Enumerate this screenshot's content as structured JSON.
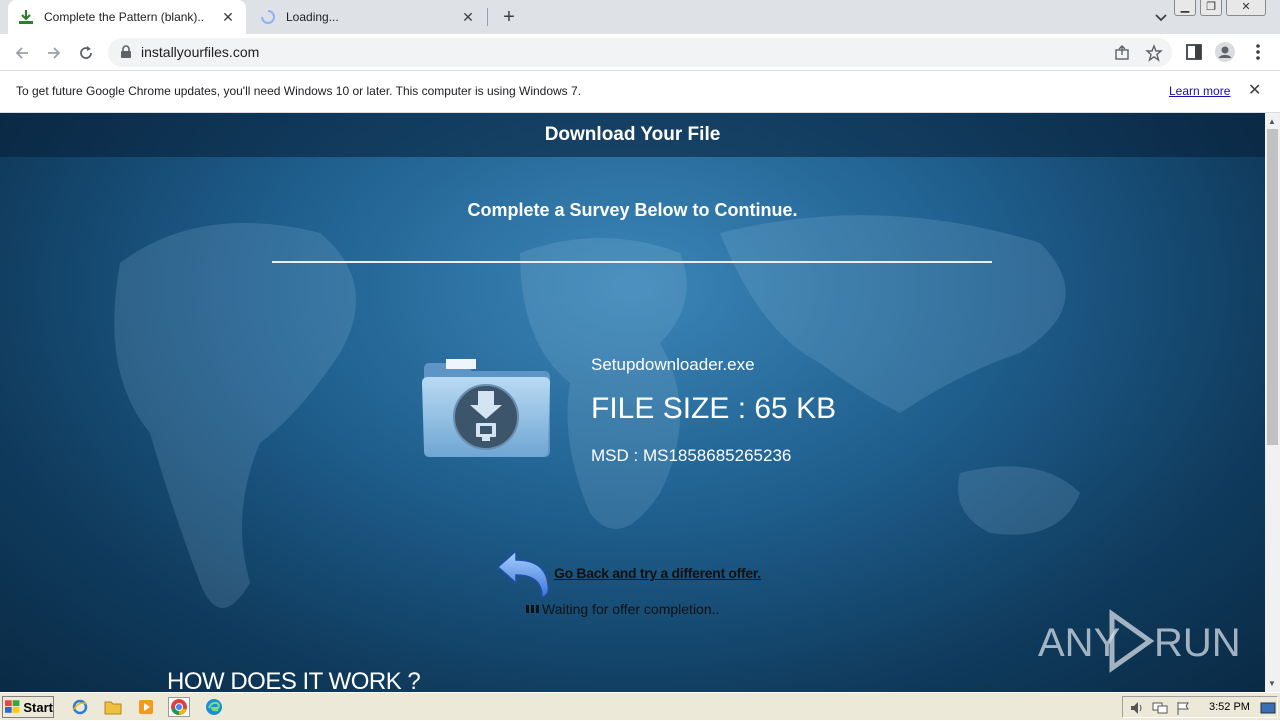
{
  "browser": {
    "tabs": [
      {
        "title": "Complete the Pattern (blank)..",
        "active": true
      },
      {
        "title": "Loading...",
        "active": false
      }
    ],
    "url": "installyourfiles.com"
  },
  "infobar": {
    "message": "To get future Google Chrome updates, you'll need Windows 10 or later. This computer is using Windows 7.",
    "link": "Learn more"
  },
  "page": {
    "header_title": "Download Your File",
    "survey_text": "Complete a Survey Below to Continue.",
    "file": {
      "name": "Setupdownloader.exe",
      "size": "FILE SIZE : 65 KB",
      "msd": "MSD : MS1858685265236"
    },
    "go_back_link": "Go Back and try a different offer.",
    "waiting_text": "Waiting for offer completion..",
    "how_heading": "HOW DOES IT WORK ?"
  },
  "watermark": "ANY RUN",
  "taskbar": {
    "start_label": "Start",
    "clock": "3:52 PM"
  },
  "colors": {
    "page_bg": "#1f5f8e",
    "link_blue": "#1a0dab",
    "taskbar": "#ece9d8"
  }
}
